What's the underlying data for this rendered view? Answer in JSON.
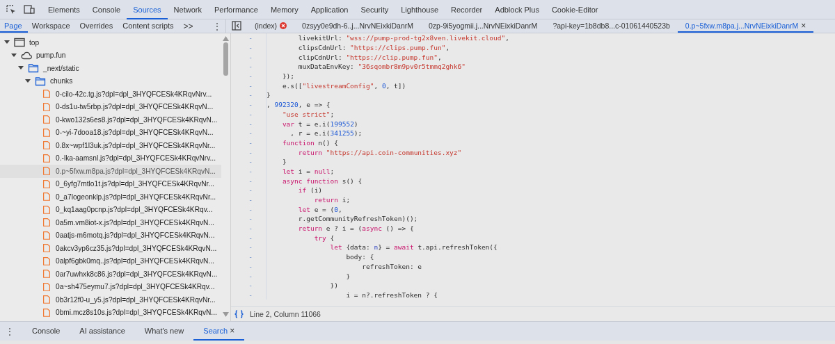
{
  "main_tabs": [
    {
      "label": "Elements",
      "selected": false
    },
    {
      "label": "Console",
      "selected": false
    },
    {
      "label": "Sources",
      "selected": true
    },
    {
      "label": "Network",
      "selected": false
    },
    {
      "label": "Performance",
      "selected": false
    },
    {
      "label": "Memory",
      "selected": false
    },
    {
      "label": "Application",
      "selected": false
    },
    {
      "label": "Security",
      "selected": false
    },
    {
      "label": "Lighthouse",
      "selected": false
    },
    {
      "label": "Recorder",
      "selected": false
    },
    {
      "label": "Adblock Plus",
      "selected": false
    },
    {
      "label": "Cookie-Editor",
      "selected": false
    }
  ],
  "navigator_tabs": [
    {
      "label": "Page",
      "selected": true
    },
    {
      "label": "Workspace",
      "selected": false
    },
    {
      "label": "Overrides",
      "selected": false
    },
    {
      "label": "Content scripts",
      "selected": false
    }
  ],
  "navigator_more": ">>",
  "navigator_menu": "⋮",
  "editor_tabs": [
    {
      "label": "(index)",
      "selected": false,
      "error": true,
      "closable": false
    },
    {
      "label": "0zsyy0e9dh-6..j...NrvNEixkiDanrM",
      "selected": false,
      "error": false,
      "closable": false
    },
    {
      "label": "0zp-9i5yogmii.j...NrvNEixkiDanrM",
      "selected": false,
      "error": false,
      "closable": false
    },
    {
      "label": "?api-key=1b8db8...c-01061440523b",
      "selected": false,
      "error": false,
      "closable": false
    },
    {
      "label": "0.p~5fxw.m8pa.j...NrvNEixkiDanrM",
      "selected": true,
      "error": false,
      "closable": true
    }
  ],
  "close_glyph": "×",
  "tree": [
    {
      "kind": "frame",
      "label": "top",
      "expanded": true,
      "children": [
        {
          "kind": "domain",
          "label": "pump.fun",
          "expanded": true,
          "children": [
            {
              "kind": "folder",
              "label": "_next/static",
              "expanded": true,
              "children": [
                {
                  "kind": "folder",
                  "label": "chunks",
                  "expanded": true,
                  "children": [
                    {
                      "kind": "file",
                      "label": "0-cilo-42c.tg.js?dpl=dpl_3HYQFCESk4KRqvNrv...",
                      "selected": false
                    },
                    {
                      "kind": "file",
                      "label": "0-ds1u-tw5rbp.js?dpl=dpl_3HYQFCESk4KRqvN...",
                      "selected": false
                    },
                    {
                      "kind": "file",
                      "label": "0-kwo132s6es8.js?dpl=dpl_3HYQFCESk4KRqvN...",
                      "selected": false
                    },
                    {
                      "kind": "file",
                      "label": "0-~yi-7dooa18.js?dpl=dpl_3HYQFCESk4KRqvN...",
                      "selected": false
                    },
                    {
                      "kind": "file",
                      "label": "0.8x~wpf1l3uk.js?dpl=dpl_3HYQFCESk4KRqvNr...",
                      "selected": false
                    },
                    {
                      "kind": "file",
                      "label": "0.-lka-aamsnl.js?dpl=dpl_3HYQFCESk4KRqvNrv...",
                      "selected": false
                    },
                    {
                      "kind": "file",
                      "label": "0.p~5fxw.m8pa.js?dpl=dpl_3HYQFCESk4KRqvN...",
                      "selected": true
                    },
                    {
                      "kind": "file",
                      "label": "0_6yfg7mtlo1t.js?dpl=dpl_3HYQFCESk4KRqvNr...",
                      "selected": false
                    },
                    {
                      "kind": "file",
                      "label": "0_a7logeonklp.js?dpl=dpl_3HYQFCESk4KRqvNr...",
                      "selected": false
                    },
                    {
                      "kind": "file",
                      "label": "0_kq1aag0pcnp.js?dpl=dpl_3HYQFCESk4KRqv...",
                      "selected": false
                    },
                    {
                      "kind": "file",
                      "label": "0a5m.vm8iot-x.js?dpl=dpl_3HYQFCESk4KRqvN...",
                      "selected": false
                    },
                    {
                      "kind": "file",
                      "label": "0aatjs-m6motq.js?dpl=dpl_3HYQFCESk4KRqvN...",
                      "selected": false
                    },
                    {
                      "kind": "file",
                      "label": "0akcv3yp6cz35.js?dpl=dpl_3HYQFCESk4KRqvN...",
                      "selected": false
                    },
                    {
                      "kind": "file",
                      "label": "0alpf6gbk0mq..js?dpl=dpl_3HYQFCESk4KRqvN...",
                      "selected": false
                    },
                    {
                      "kind": "file",
                      "label": "0ar7uwhxk8c86.js?dpl=dpl_3HYQFCESk4KRqvN...",
                      "selected": false
                    },
                    {
                      "kind": "file",
                      "label": "0a~sh475eymu7.js?dpl=dpl_3HYQFCESk4KRqv...",
                      "selected": false
                    },
                    {
                      "kind": "file",
                      "label": "0b3r12f0-u_y5.js?dpl=dpl_3HYQFCESk4KRqvNr...",
                      "selected": false
                    },
                    {
                      "kind": "file",
                      "label": "0bmi.mcz8s10s.js?dpl=dpl_3HYQFCESk4KRqvN...",
                      "selected": false
                    }
                  ]
                }
              ]
            }
          ]
        }
      ]
    }
  ],
  "code_lines": [
    {
      "gutter": "-",
      "tokens": [
        {
          "kind": "plain",
          "text": "        livekitUrl: "
        },
        {
          "kind": "string",
          "text": "\"wss://pump-prod-tg2x8ven.livekit.cloud\""
        },
        {
          "kind": "plain",
          "text": ","
        }
      ]
    },
    {
      "gutter": "-",
      "tokens": [
        {
          "kind": "plain",
          "text": "        clipsCdnUrl: "
        },
        {
          "kind": "string",
          "text": "\"https://clips.pump.fun\""
        },
        {
          "kind": "plain",
          "text": ","
        }
      ]
    },
    {
      "gutter": "-",
      "tokens": [
        {
          "kind": "plain",
          "text": "        clipCdnUrl: "
        },
        {
          "kind": "string",
          "text": "\"https://clip.pump.fun\""
        },
        {
          "kind": "plain",
          "text": ","
        }
      ]
    },
    {
      "gutter": "-",
      "tokens": [
        {
          "kind": "plain",
          "text": "        muxDataEnvKey: "
        },
        {
          "kind": "string",
          "text": "\"36sqombr8m9pv0r5tmmq2ghk6\""
        }
      ]
    },
    {
      "gutter": "-",
      "tokens": [
        {
          "kind": "plain",
          "text": "    });"
        }
      ]
    },
    {
      "gutter": "-",
      "tokens": [
        {
          "kind": "plain",
          "text": "    e.s(["
        },
        {
          "kind": "string",
          "text": "\"livestreamConfig\""
        },
        {
          "kind": "plain",
          "text": ", "
        },
        {
          "kind": "number",
          "text": "0"
        },
        {
          "kind": "plain",
          "text": ", t])"
        }
      ]
    },
    {
      "gutter": "-",
      "tokens": [
        {
          "kind": "plain",
          "text": "}"
        }
      ]
    },
    {
      "gutter": "-",
      "tokens": [
        {
          "kind": "plain",
          "text": ", "
        },
        {
          "kind": "number",
          "text": "992320"
        },
        {
          "kind": "plain",
          "text": ", e => {"
        }
      ]
    },
    {
      "gutter": "-",
      "tokens": [
        {
          "kind": "string",
          "text": "    \"use strict\""
        },
        {
          "kind": "plain",
          "text": ";"
        }
      ]
    },
    {
      "gutter": "-",
      "tokens": [
        {
          "kind": "keyword",
          "text": "    var"
        },
        {
          "kind": "plain",
          "text": " t = e.i("
        },
        {
          "kind": "number",
          "text": "199552"
        },
        {
          "kind": "plain",
          "text": ")"
        }
      ]
    },
    {
      "gutter": "-",
      "tokens": [
        {
          "kind": "plain",
          "text": "      , r = e.i("
        },
        {
          "kind": "number",
          "text": "341255"
        },
        {
          "kind": "plain",
          "text": ");"
        }
      ]
    },
    {
      "gutter": "-",
      "tokens": [
        {
          "kind": "keyword",
          "text": "    function"
        },
        {
          "kind": "plain",
          "text": " n() {"
        }
      ]
    },
    {
      "gutter": "-",
      "tokens": [
        {
          "kind": "keyword",
          "text": "        return"
        },
        {
          "kind": "string",
          "text": " \"https://api.coin-communities.xyz\""
        }
      ]
    },
    {
      "gutter": "-",
      "tokens": [
        {
          "kind": "plain",
          "text": "    }"
        }
      ]
    },
    {
      "gutter": "-",
      "tokens": [
        {
          "kind": "keyword",
          "text": "    let"
        },
        {
          "kind": "plain",
          "text": " i = "
        },
        {
          "kind": "keyword",
          "text": "null"
        },
        {
          "kind": "plain",
          "text": ";"
        }
      ]
    },
    {
      "gutter": "-",
      "tokens": [
        {
          "kind": "keyword",
          "text": "    async function"
        },
        {
          "kind": "plain",
          "text": " s() {"
        }
      ]
    },
    {
      "gutter": "-",
      "tokens": [
        {
          "kind": "keyword",
          "text": "        if"
        },
        {
          "kind": "plain",
          "text": " (i)"
        }
      ]
    },
    {
      "gutter": "-",
      "tokens": [
        {
          "kind": "keyword",
          "text": "            return"
        },
        {
          "kind": "plain",
          "text": " i;"
        }
      ]
    },
    {
      "gutter": "-",
      "tokens": [
        {
          "kind": "keyword",
          "text": "        let"
        },
        {
          "kind": "plain",
          "text": " e = ("
        },
        {
          "kind": "number",
          "text": "0"
        },
        {
          "kind": "plain",
          "text": ","
        }
      ]
    },
    {
      "gutter": "-",
      "tokens": [
        {
          "kind": "plain",
          "text": "        r.getCommunityRefreshToken)();"
        }
      ]
    },
    {
      "gutter": "-",
      "tokens": [
        {
          "kind": "keyword",
          "text": "        return"
        },
        {
          "kind": "plain",
          "text": " e ? i = ("
        },
        {
          "kind": "keyword",
          "text": "async"
        },
        {
          "kind": "plain",
          "text": " () => {"
        }
      ]
    },
    {
      "gutter": "-",
      "tokens": [
        {
          "kind": "keyword",
          "text": "            try"
        },
        {
          "kind": "plain",
          "text": " {"
        }
      ]
    },
    {
      "gutter": "-",
      "tokens": [
        {
          "kind": "keyword",
          "text": "                let"
        },
        {
          "kind": "plain",
          "text": " {data: "
        },
        {
          "kind": "def",
          "text": "n"
        },
        {
          "kind": "plain",
          "text": "} = "
        },
        {
          "kind": "keyword",
          "text": "await"
        },
        {
          "kind": "plain",
          "text": " t.api.refreshToken({"
        }
      ]
    },
    {
      "gutter": "-",
      "tokens": [
        {
          "kind": "plain",
          "text": "                    body: {"
        }
      ]
    },
    {
      "gutter": "-",
      "tokens": [
        {
          "kind": "plain",
          "text": "                        refreshToken: e"
        }
      ]
    },
    {
      "gutter": "-",
      "tokens": [
        {
          "kind": "plain",
          "text": "                    }"
        }
      ]
    },
    {
      "gutter": "-",
      "tokens": [
        {
          "kind": "plain",
          "text": "                })"
        }
      ]
    },
    {
      "gutter": "-",
      "tokens": [
        {
          "kind": "plain",
          "text": "                    i = n?.refreshToken ? {"
        }
      ]
    }
  ],
  "status_bar": {
    "position": "Line 2, Column 11066"
  },
  "drawer_menu": "⋮",
  "drawer_tabs": [
    {
      "label": "Console",
      "selected": false,
      "closable": false
    },
    {
      "label": "AI assistance",
      "selected": false,
      "closable": false
    },
    {
      "label": "What's new",
      "selected": false,
      "closable": false
    },
    {
      "label": "Search",
      "selected": true,
      "closable": true
    }
  ]
}
